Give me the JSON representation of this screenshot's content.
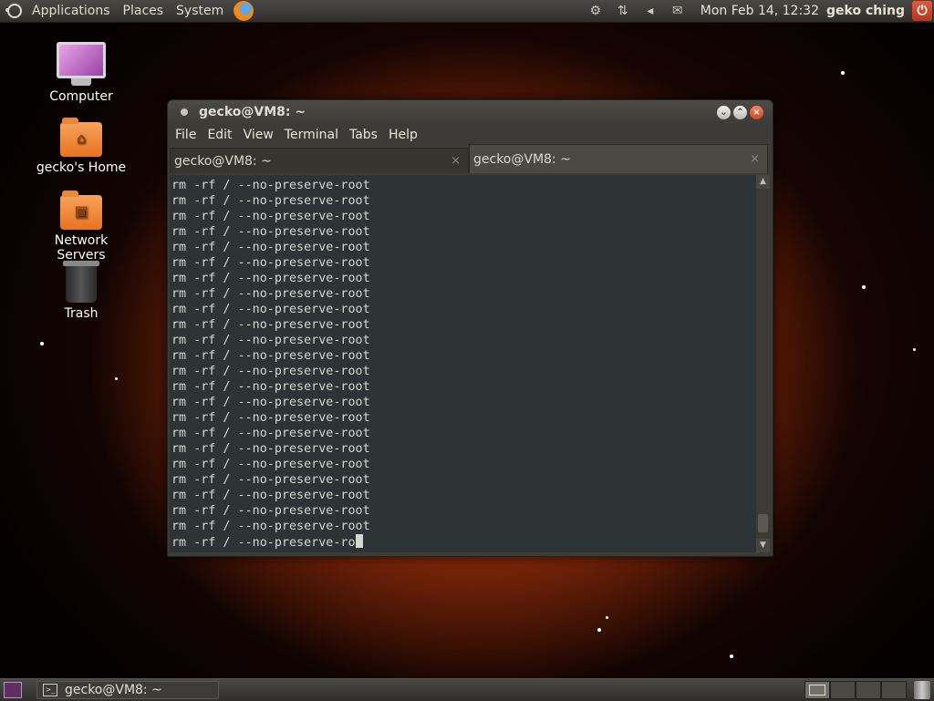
{
  "top_panel": {
    "menus": [
      "Applications",
      "Places",
      "System"
    ],
    "clock": "Mon Feb 14, 12:32",
    "user": "geko ching"
  },
  "desktop_icons": [
    {
      "label": "Computer"
    },
    {
      "label": "gecko's Home"
    },
    {
      "label": "Network Servers"
    },
    {
      "label": "Trash"
    }
  ],
  "terminal": {
    "title": "gecko@VM8: ~",
    "menu": [
      "File",
      "Edit",
      "View",
      "Terminal",
      "Tabs",
      "Help"
    ],
    "tabs": [
      {
        "label": "gecko@VM8: ~",
        "close": "×"
      },
      {
        "label": "gecko@VM8: ~",
        "close": "×"
      }
    ],
    "lines": [
      "rm -rf / --no-preserve-root",
      "rm -rf / --no-preserve-root",
      "rm -rf / --no-preserve-root",
      "rm -rf / --no-preserve-root",
      "rm -rf / --no-preserve-root",
      "rm -rf / --no-preserve-root",
      "rm -rf / --no-preserve-root",
      "rm -rf / --no-preserve-root",
      "rm -rf / --no-preserve-root",
      "rm -rf / --no-preserve-root",
      "rm -rf / --no-preserve-root",
      "rm -rf / --no-preserve-root",
      "rm -rf / --no-preserve-root",
      "rm -rf / --no-preserve-root",
      "rm -rf / --no-preserve-root",
      "rm -rf / --no-preserve-root",
      "rm -rf / --no-preserve-root",
      "rm -rf / --no-preserve-root",
      "rm -rf / --no-preserve-root",
      "rm -rf / --no-preserve-root",
      "rm -rf / --no-preserve-root",
      "rm -rf / --no-preserve-root",
      "rm -rf / --no-preserve-root"
    ],
    "current_input": "rm -rf / --no-preserve-ro"
  },
  "bottom_panel": {
    "task_label": "gecko@VM8: ~"
  }
}
